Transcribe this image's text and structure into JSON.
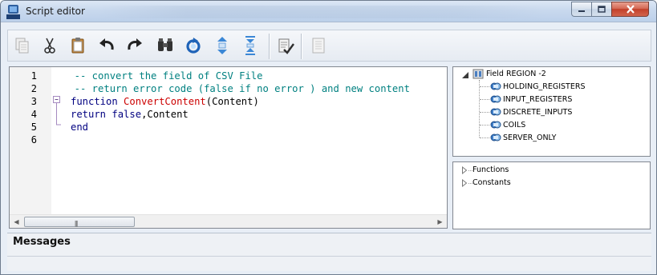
{
  "window": {
    "title": "Script editor",
    "app_icon_text": "KEPC"
  },
  "toolbar": {
    "buttons": [
      {
        "name": "copy-button",
        "icon": "copy-icon",
        "enabled": false
      },
      {
        "name": "cut-button",
        "icon": "scissors-icon",
        "enabled": true
      },
      {
        "name": "paste-button",
        "icon": "clipboard-icon",
        "enabled": true
      },
      {
        "name": "undo-button",
        "icon": "undo-icon",
        "enabled": true
      },
      {
        "name": "redo-button",
        "icon": "redo-icon",
        "enabled": true
      },
      {
        "name": "find-button",
        "icon": "binoculars-icon",
        "enabled": true
      },
      {
        "name": "refresh-button",
        "icon": "refresh-icon",
        "enabled": true
      },
      {
        "name": "expand-button",
        "icon": "expand-vertical-icon",
        "enabled": true
      },
      {
        "name": "collapse-button",
        "icon": "collapse-vertical-icon",
        "enabled": true
      },
      {
        "name": "check-script-button",
        "icon": "check-script-icon",
        "enabled": true
      },
      {
        "name": "document-button",
        "icon": "document-icon",
        "enabled": false
      }
    ]
  },
  "editor": {
    "line_numbers": [
      "1",
      "2",
      "3",
      "4",
      "5",
      "6"
    ],
    "lines": [
      [
        {
          "t": "  -- convert the field of CSV File",
          "c": "comment"
        }
      ],
      [
        {
          "t": "  -- return error code (false if no error ) and new content",
          "c": "comment"
        }
      ],
      [
        {
          "t": "function ",
          "c": "kw"
        },
        {
          "t": "ConvertContent",
          "c": "fn"
        },
        {
          "t": "(Content)",
          "c": "plain"
        }
      ],
      [
        {
          "t": "return ",
          "c": "kw"
        },
        {
          "t": "false",
          "c": "kw"
        },
        {
          "t": ",Content",
          "c": "plain"
        }
      ],
      [
        {
          "t": "end",
          "c": "kw"
        }
      ],
      [
        {
          "t": "",
          "c": "plain"
        }
      ]
    ]
  },
  "tree": {
    "root": "Field REGION -2",
    "children": [
      "HOLDING_REGISTERS",
      "INPUT_REGISTERS",
      "DISCRETE_INPUTS",
      "COILS",
      "SERVER_ONLY"
    ]
  },
  "tree2": {
    "items": [
      "Functions",
      "Constants"
    ]
  },
  "messages": {
    "title": "Messages"
  },
  "colors": {
    "comment": "#008080",
    "keyword": "#000080",
    "function_name": "#cc0000"
  }
}
